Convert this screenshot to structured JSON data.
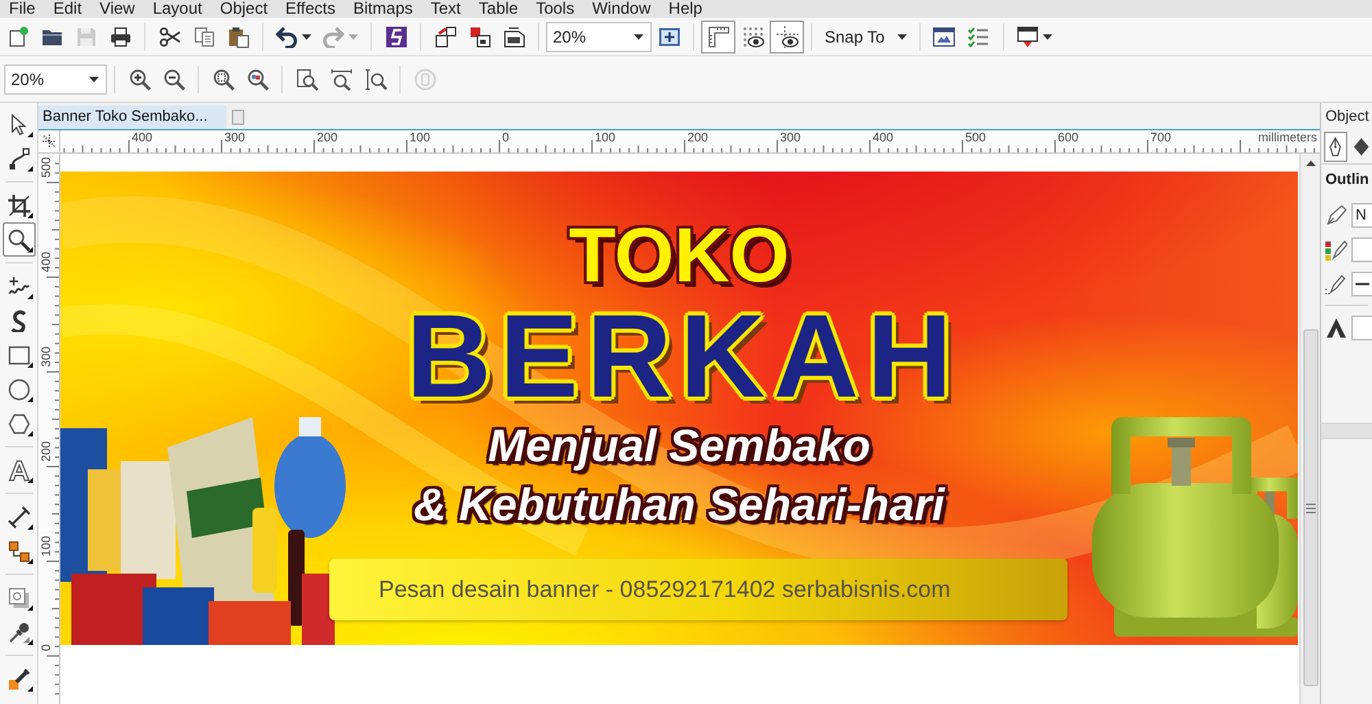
{
  "menu_bar": {
    "items": [
      "File",
      "Edit",
      "View",
      "Layout",
      "Object",
      "Effects",
      "Bitmaps",
      "Text",
      "Table",
      "Tools",
      "Window",
      "Help"
    ]
  },
  "standard_toolbar": {
    "groups": [
      [
        {
          "kind": "button",
          "disabled": false
        },
        {
          "kind": "button",
          "disabled": false
        },
        {
          "kind": "button",
          "disabled": true
        },
        {
          "kind": "button",
          "disabled": false
        }
      ],
      [
        {
          "kind": "button",
          "disabled": false
        },
        {
          "kind": "button",
          "disabled": false
        },
        {
          "kind": "button",
          "disabled": false
        }
      ],
      [
        {
          "kind": "split",
          "disabled": false
        },
        {
          "kind": "split",
          "disabled": true
        }
      ],
      [
        {
          "kind": "button",
          "disabled": false
        }
      ],
      [
        {
          "kind": "button",
          "disabled": false
        },
        {
          "kind": "button",
          "disabled": false
        },
        {
          "kind": "button",
          "disabled": false
        }
      ],
      [
        {
          "kind": "combo",
          "value": "20%"
        },
        {
          "kind": "button",
          "disabled": false
        }
      ],
      [
        {
          "kind": "toggle",
          "on": true
        },
        {
          "kind": "toggle",
          "on": false
        },
        {
          "kind": "toggle",
          "on": true
        }
      ],
      [
        {
          "kind": "dropdown",
          "label": "Snap To"
        }
      ],
      [
        {
          "kind": "button",
          "disabled": false
        },
        {
          "kind": "button",
          "disabled": false
        }
      ],
      [
        {
          "kind": "split",
          "disabled": false
        }
      ]
    ]
  },
  "zoom_toolbar": {
    "groups": [
      [
        {
          "kind": "combo",
          "value": "20%"
        }
      ],
      [
        {
          "kind": "button",
          "disabled": false
        },
        {
          "kind": "button",
          "disabled": false
        }
      ],
      [
        {
          "kind": "button",
          "disabled": false
        },
        {
          "kind": "button",
          "disabled": false
        }
      ],
      [
        {
          "kind": "button",
          "disabled": false
        },
        {
          "kind": "button",
          "disabled": false
        },
        {
          "kind": "button",
          "disabled": false
        }
      ],
      [
        {
          "kind": "button",
          "disabled": true
        }
      ]
    ]
  },
  "toolbox": {
    "groups": [
      [
        {
          "selected": false,
          "flyout": true
        },
        {
          "selected": false,
          "flyout": true
        }
      ],
      [
        {
          "selected": false,
          "flyout": true
        },
        {
          "selected": true,
          "flyout": true
        }
      ],
      [
        {
          "selected": false,
          "flyout": true
        },
        {
          "selected": false,
          "flyout": false
        },
        {
          "selected": false,
          "flyout": true
        },
        {
          "selected": false,
          "flyout": true
        },
        {
          "selected": false,
          "flyout": true
        }
      ],
      [
        {
          "selected": false,
          "flyout": true
        }
      ],
      [
        {
          "selected": false,
          "flyout": true
        },
        {
          "selected": false,
          "flyout": true
        }
      ],
      [
        {
          "selected": false,
          "flyout": true
        },
        {
          "selected": false,
          "flyout": true
        }
      ],
      [
        {
          "selected": false,
          "flyout": true
        }
      ]
    ]
  },
  "document_tabs": [
    {
      "title": "Banner Toko Sembako...",
      "selected": true
    }
  ],
  "rulers": {
    "horizontal": [
      "400",
      "300",
      "200",
      "100",
      "0",
      "100",
      "200",
      "300",
      "400",
      "500",
      "600",
      "700"
    ],
    "unit": "millimeters",
    "vertical": [
      "500",
      "400",
      "300",
      "200",
      "100",
      "0"
    ]
  },
  "banner": {
    "name_top": "TOKO",
    "name_main": "BERKAH",
    "tagline": [
      "Menjual Sembako",
      "& Kebutuhan Sehari-hari"
    ],
    "contact": "Pesan desain banner - 085292171402 serbabisnis.com"
  },
  "object_docker": {
    "title": "Object",
    "tabs": [
      {
        "selected": true
      },
      {
        "selected": false
      }
    ],
    "section": "Outlin",
    "fields": [
      {
        "kind": "text",
        "value": "N"
      },
      {
        "kind": "color"
      },
      {
        "kind": "style"
      },
      {
        "kind": "number"
      }
    ]
  }
}
